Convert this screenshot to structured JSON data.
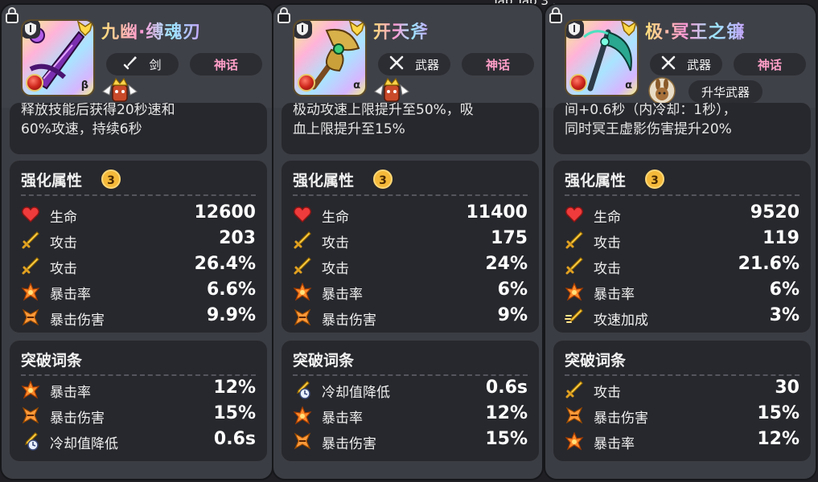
{
  "top_overlay_text": "Tap Tap 3 ...",
  "colors": {
    "card_bg": "#3b3d44",
    "panel_bg": "#27282d",
    "mythic": "#ff9fc8",
    "level_badge": "#f5b93a"
  },
  "cards": [
    {
      "name": "九幽·缚魂刃",
      "type": "剑",
      "rarity": "神话",
      "greek": "β",
      "description": "释放技能后获得20秒速和\n60%攻速，持续6秒",
      "enhance_title": "强化属性",
      "enhance_level": "3",
      "stats": [
        {
          "icon": "heart-icon",
          "label": "生命",
          "value": "12600"
        },
        {
          "icon": "sword-icon",
          "label": "攻击",
          "value": "203"
        },
        {
          "icon": "sword-icon",
          "label": "攻击",
          "value": "26.4%"
        },
        {
          "icon": "crit-rate-icon",
          "label": "暴击率",
          "value": "6.6%"
        },
        {
          "icon": "crit-damage-icon",
          "label": "暴击伤害",
          "value": "9.9%"
        }
      ],
      "break_title": "突破词条",
      "breakthrough": [
        {
          "icon": "crit-rate-icon",
          "label": "暴击率",
          "value": "12%"
        },
        {
          "icon": "crit-damage-icon",
          "label": "暴击伤害",
          "value": "15%"
        },
        {
          "icon": "cooldown-icon",
          "label": "冷却值降低",
          "value": "0.6s"
        }
      ]
    },
    {
      "name": "开天斧",
      "type": "武器",
      "rarity": "神话",
      "greek": "α",
      "description": "极动攻速上限提升至50%，吸\n血上限提升至15%",
      "enhance_title": "强化属性",
      "enhance_level": "3",
      "stats": [
        {
          "icon": "heart-icon",
          "label": "生命",
          "value": "11400"
        },
        {
          "icon": "sword-icon",
          "label": "攻击",
          "value": "175"
        },
        {
          "icon": "sword-icon",
          "label": "攻击",
          "value": "24%"
        },
        {
          "icon": "crit-rate-icon",
          "label": "暴击率",
          "value": "6%"
        },
        {
          "icon": "crit-damage-icon",
          "label": "暴击伤害",
          "value": "9%"
        }
      ],
      "break_title": "突破词条",
      "breakthrough": [
        {
          "icon": "cooldown-icon",
          "label": "冷却值降低",
          "value": "0.6s"
        },
        {
          "icon": "crit-rate-icon",
          "label": "暴击率",
          "value": "12%"
        },
        {
          "icon": "crit-damage-icon",
          "label": "暴击伤害",
          "value": "15%"
        }
      ]
    },
    {
      "name": "极·冥王之镰",
      "type": "武器",
      "rarity": "神话",
      "greek": "α",
      "upgrade_label": "升华武器",
      "description": "间+0.6秒（内冷却：1秒），\n同时冥王虚影伤害提升20%",
      "enhance_title": "强化属性",
      "enhance_level": "3",
      "stats": [
        {
          "icon": "heart-icon",
          "label": "生命",
          "value": "9520"
        },
        {
          "icon": "sword-icon",
          "label": "攻击",
          "value": "119"
        },
        {
          "icon": "sword-icon",
          "label": "攻击",
          "value": "21.6%"
        },
        {
          "icon": "crit-rate-icon",
          "label": "暴击率",
          "value": "6%"
        },
        {
          "icon": "attack-speed-icon",
          "label": "攻速加成",
          "value": "3%"
        }
      ],
      "break_title": "突破词条",
      "breakthrough": [
        {
          "icon": "sword-icon",
          "label": "攻击",
          "value": "30"
        },
        {
          "icon": "crit-damage-icon",
          "label": "暴击伤害",
          "value": "15%"
        },
        {
          "icon": "crit-rate-icon",
          "label": "暴击率",
          "value": "12%"
        }
      ]
    }
  ]
}
